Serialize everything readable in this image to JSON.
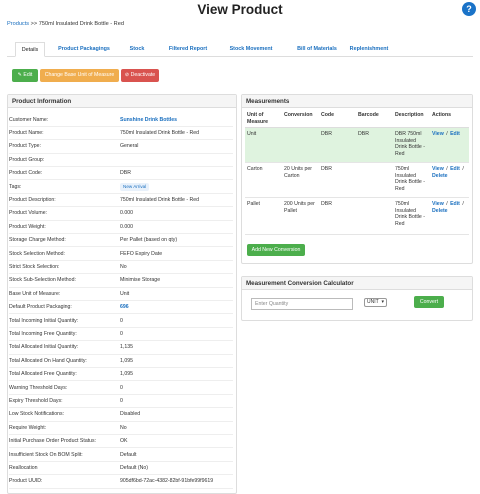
{
  "page": {
    "title": "View Product",
    "help_icon": "?"
  },
  "breadcrumb": {
    "link": "Products",
    "separator": ">>",
    "current": "750ml Insulated Drink Bottle - Red"
  },
  "tabs": [
    {
      "label": "Details",
      "active": true
    },
    {
      "label": "Product Packagings",
      "active": false
    },
    {
      "label": "Stock",
      "active": false
    },
    {
      "label": "Filtered Report",
      "active": false
    },
    {
      "label": "Stock Movement",
      "active": false
    },
    {
      "label": "Bill of Materials",
      "active": false
    },
    {
      "label": "Replenishment",
      "active": false
    }
  ],
  "actions": {
    "edit": "Edit",
    "change": "Change Base Unit of Measure",
    "deactivate": "Deactivate"
  },
  "product_info": {
    "title": "Product Information",
    "rows": [
      {
        "label": "Customer Name:",
        "value": "Sunshine Drink Bottles",
        "style": "link"
      },
      {
        "label": "Product Name:",
        "value": "750ml Insulated Drink Bottle - Red"
      },
      {
        "label": "Product Type:",
        "value": "General"
      },
      {
        "label": "Product Group:",
        "value": ""
      },
      {
        "label": "Product Code:",
        "value": "DBR"
      },
      {
        "label": "Tags:",
        "value": "New Arrival",
        "style": "badge"
      },
      {
        "label": "Product Description:",
        "value": "750ml Insulated Drink Bottle - Red"
      },
      {
        "label": "Product Volume:",
        "value": "0.000"
      },
      {
        "label": "Product Weight:",
        "value": "0.000"
      },
      {
        "label": "Storage Charge Method:",
        "value": "Per Pallet (based on qty)"
      },
      {
        "label": "Stock Selection Method:",
        "value": "FEFO Expiry Date"
      },
      {
        "label": "Strict Stock Selection:",
        "value": "No"
      },
      {
        "label": "Stock Sub-Selection Method:",
        "value": "Minimise Storage"
      },
      {
        "label": "Base Unit of Measure:",
        "value": "Unit"
      },
      {
        "label": "Default Product Packaging:",
        "value": "696",
        "style": "link"
      },
      {
        "label": "Total Incoming Initial Quantity:",
        "value": "0"
      },
      {
        "label": "Total Incoming Free Quantity:",
        "value": "0"
      },
      {
        "label": "Total Allocated Initial Quantity:",
        "value": "1,135"
      },
      {
        "label": "Total Allocated On Hand Quantity:",
        "value": "1,095"
      },
      {
        "label": "Total Allocated Free Quantity:",
        "value": "1,095"
      },
      {
        "label": "Warning Threshold Days:",
        "value": "0"
      },
      {
        "label": "Expiry Threshold Days:",
        "value": "0"
      },
      {
        "label": "Low Stock Notifications:",
        "value": "Disabled"
      },
      {
        "label": "Require Weight:",
        "value": "No"
      },
      {
        "label": "Initial Purchase Order Product Status:",
        "value": "OK"
      },
      {
        "label": "Insufficient Stock On BOM Split:",
        "value": "Default"
      },
      {
        "label": "Reallocation",
        "value": "Default (No)"
      },
      {
        "label": "Product UUID:",
        "value": "905df6bd-72ac-4382-82bf-91bfe99f9619"
      }
    ]
  },
  "measurements": {
    "title": "Measurements",
    "headers": {
      "unit": [
        "Unit of",
        "Measure"
      ],
      "conversion": "Conversion",
      "code": "Code",
      "barcode": "Barcode",
      "description": "Description",
      "actions": "Actions"
    },
    "rows": [
      {
        "unit": "Unit",
        "conversion": [],
        "code": "DBR",
        "barcode": "DBR",
        "description": [
          "DBR 750ml",
          "Insulated",
          "Drink Bottle -",
          "Red"
        ],
        "links": [
          "View",
          "/",
          "Edit"
        ],
        "highlight": true
      },
      {
        "unit": "Carton",
        "conversion": [
          "20 Units per",
          "Carton"
        ],
        "code": "DBR",
        "barcode": "",
        "description": [
          "750ml",
          "Insulated",
          "Drink Bottle -",
          "Red"
        ],
        "links": [
          "View",
          "/",
          "Edit",
          "/",
          "Delete"
        ],
        "highlight": false
      },
      {
        "unit": "Pallet",
        "conversion": [
          "200 Units per",
          "Pallet"
        ],
        "code": "DBR",
        "barcode": "",
        "description": [
          "750ml",
          "Insulated",
          "Drink Bottle -",
          "Red"
        ],
        "links": [
          "View",
          "/",
          "Edit",
          "/",
          "Delete"
        ],
        "highlight": false
      }
    ],
    "add_button": "Add New Conversion"
  },
  "calculator": {
    "title": "Measurement Conversion Calculator",
    "quantity_placeholder": "Enter Quantity",
    "unit_value": "UNIT",
    "convert_button": "Convert"
  },
  "colors": {
    "link": "#1a6fbf",
    "green": "#4cae4c",
    "orange": "#f0ad4e",
    "red": "#d9534f",
    "highlight": "#dff3df",
    "help": "#1a73c8"
  }
}
